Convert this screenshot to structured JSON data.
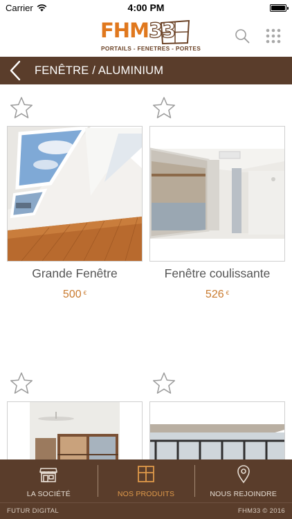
{
  "status_bar": {
    "carrier": "Carrier",
    "time": "4:00 PM"
  },
  "header": {
    "logo_main": "FHM",
    "logo_num": "33",
    "logo_tagline": "PORTAILS - FENETRES - PORTES",
    "icons": [
      "search-icon",
      "grid-icon"
    ]
  },
  "title_bar": {
    "title": "FENÊTRE / ALUMINIUM"
  },
  "products": [
    {
      "name": "Grande Fenêtre",
      "price": "500",
      "currency": "€"
    },
    {
      "name": "Fenêtre coulissante",
      "price": "526",
      "currency": "€"
    },
    {
      "name": "",
      "price": "",
      "currency": ""
    },
    {
      "name": "",
      "price": "",
      "currency": ""
    }
  ],
  "tabs": [
    {
      "label": "LA SOCIÉTÉ",
      "icon": "shop-icon",
      "active": false
    },
    {
      "label": "NOS PRODUITS",
      "icon": "window-icon",
      "active": true
    },
    {
      "label": "NOUS REJOINDRE",
      "icon": "location-pin-icon",
      "active": false
    }
  ],
  "footer": {
    "left": "FUTUR DIGITAL",
    "right": "FHM33 © 2016"
  },
  "colors": {
    "brown": "#5a3d2b",
    "orange": "#e0781e",
    "price": "#c97a2e",
    "active_tab": "#e09a4a"
  }
}
